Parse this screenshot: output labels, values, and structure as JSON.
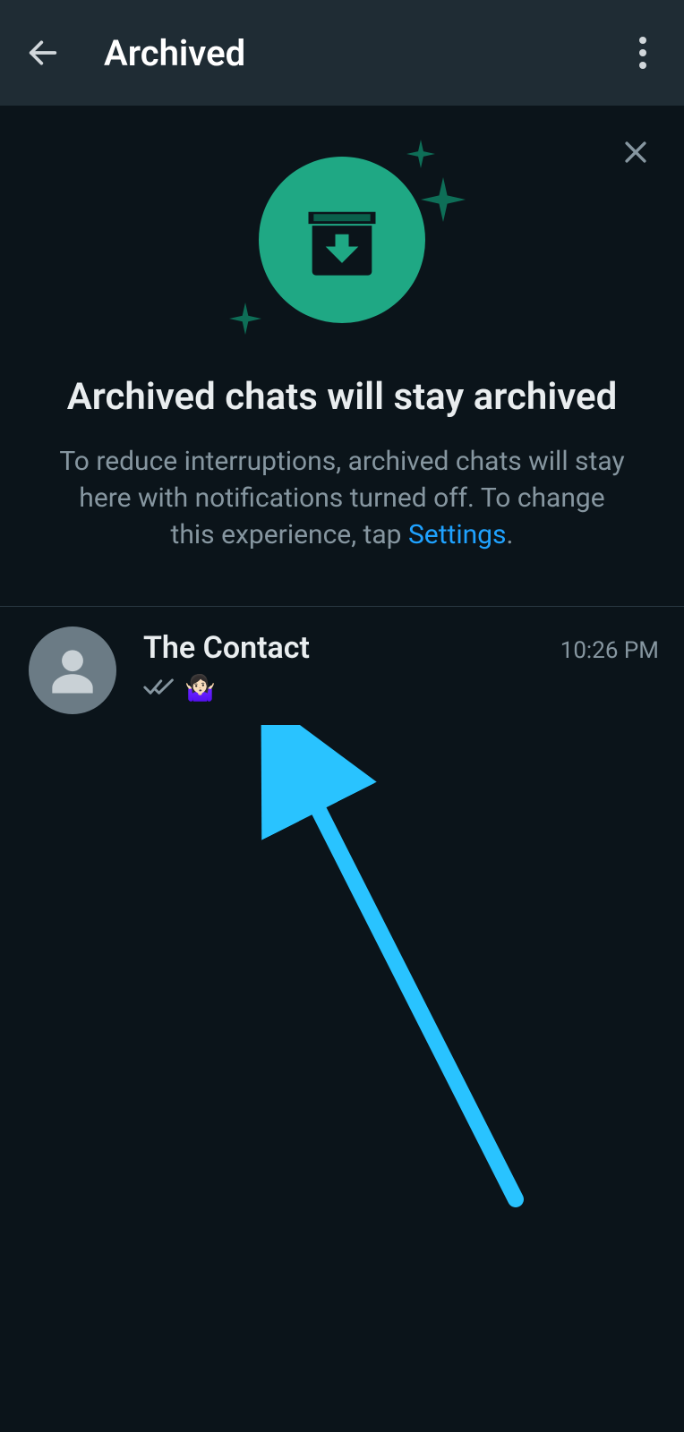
{
  "header": {
    "title": "Archived"
  },
  "banner": {
    "title": "Archived chats will stay archived",
    "sub_pre": "To reduce interruptions, archived chats will stay here with notifications turned off. To change this experience, tap ",
    "settings_label": "Settings",
    "sub_post": "."
  },
  "chats": [
    {
      "name": "The Contact",
      "time": "10:26 PM",
      "preview_emoji": "🤷🏻‍♀️"
    }
  ],
  "colors": {
    "accent": "#1fa884",
    "link": "#1fa2ff",
    "arrow": "#29c3ff"
  }
}
